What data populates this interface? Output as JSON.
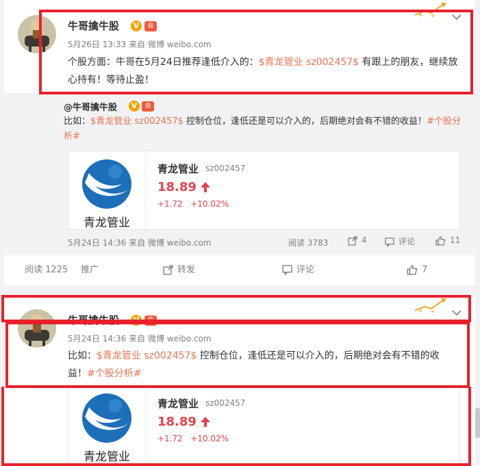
{
  "post1": {
    "author": "牛哥擒牛股",
    "v_badge": "V",
    "level_badge": "会",
    "meta_time": "5月26日 13:33",
    "meta_from": "来自 微博 weibo.com",
    "text_pre": "个股方面：牛哥在5月24日推荐逢低介入的：",
    "text_link": "$青龙管业 sz002457$",
    "text_post": " 有跟上的朋友，继续放心持有！等待止盈！",
    "repost": {
      "author": "@牛哥擒牛股",
      "text_pre": "比如：",
      "text_link": "$青龙管业 sz002457$",
      "text_mid": " 控制仓位，逢低还是可以介入的，后期绝对会有不错的收益！",
      "text_tag": "#个股分析#",
      "stock": {
        "logo_text": "青龙管业",
        "name": "青龙管业",
        "code": "sz002457",
        "price": "18.89",
        "change": "+1.72",
        "change_pct": "+10.02%"
      },
      "footer": {
        "time": "5月24日 14:36",
        "from": "来自 微博 weibo.com",
        "reads": "阅读 3783",
        "reposts": "4",
        "comments": "评论",
        "likes": "11"
      }
    },
    "actions": {
      "reads": "阅读 1225",
      "promote": "推广",
      "repost": "转发",
      "comment": "评论",
      "like": "7"
    }
  },
  "post2": {
    "author": "牛哥擒牛股",
    "v_badge": "V",
    "level_badge": "会",
    "meta_time": "5月24日 14:36",
    "meta_from": "来自 微博 weibo.com",
    "text_pre": "比如：",
    "text_link": "$青龙管业 sz002457$",
    "text_mid": " 控制仓位，逢低还是可以介入的，后期绝对会有不错的收益！",
    "text_tag": "#个股分析#",
    "stock": {
      "logo_text": "青龙管业",
      "name": "青龙管业",
      "code": "sz002457",
      "price": "18.89",
      "change": "+1.72",
      "change_pct": "+10.02%"
    }
  },
  "colors": {
    "link": "#eb7350",
    "price_up": "#e8424b",
    "highlight_box": "#e8202a"
  }
}
